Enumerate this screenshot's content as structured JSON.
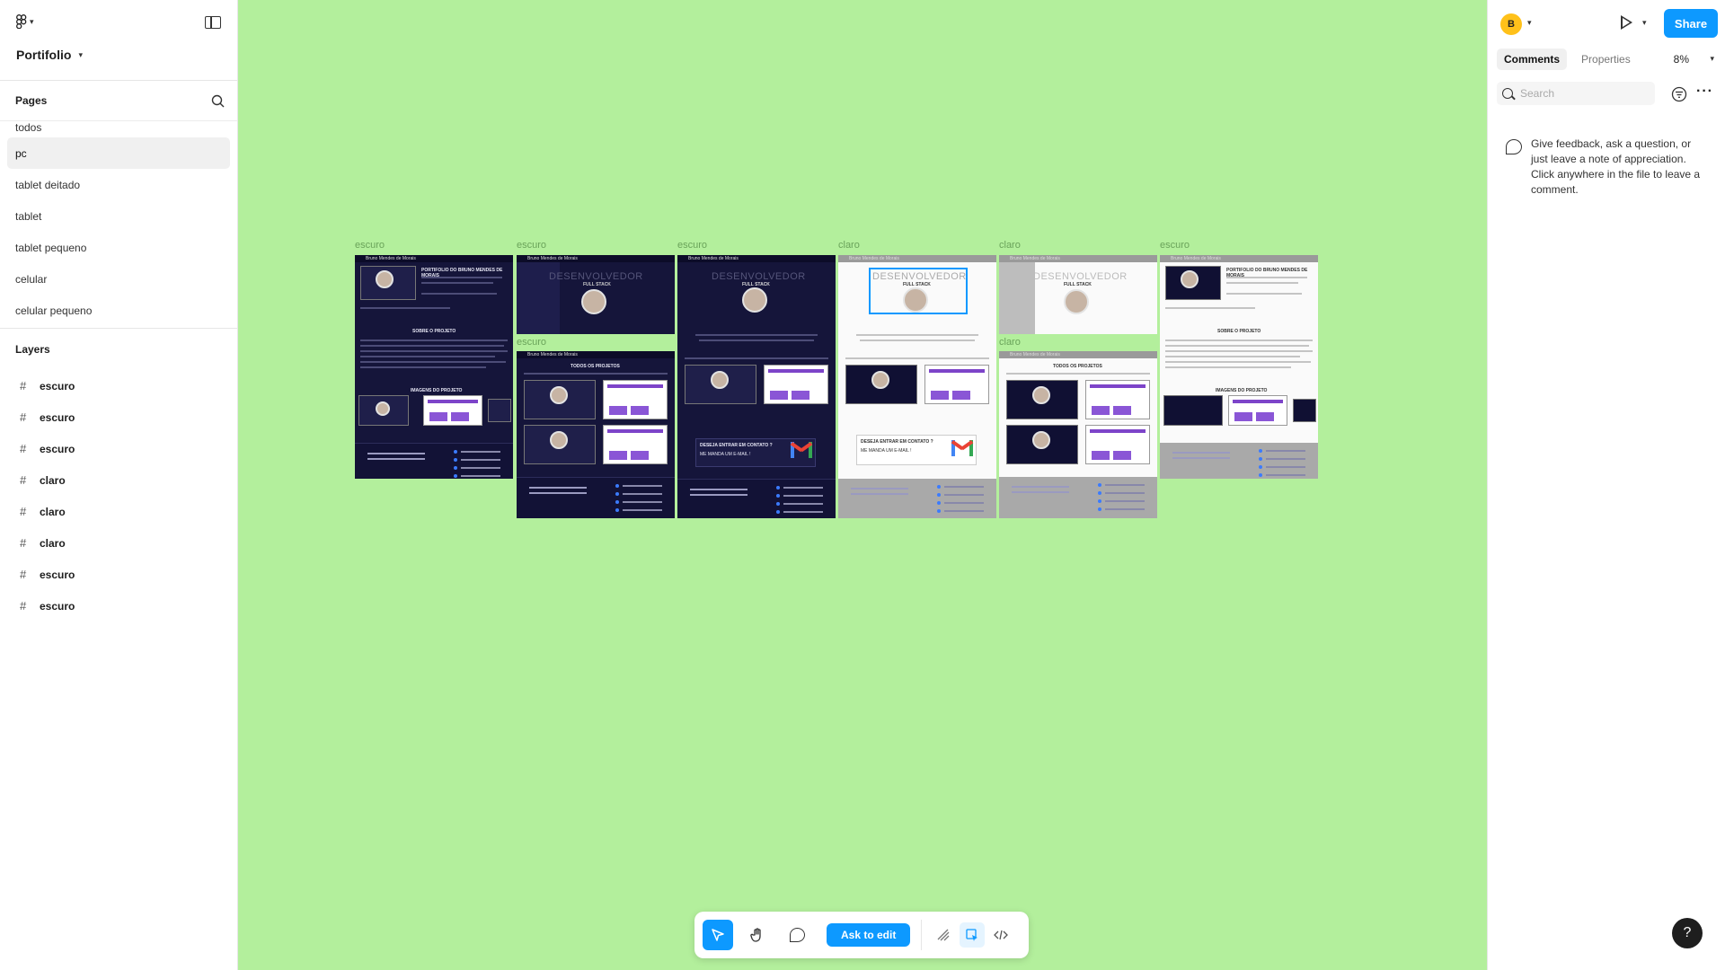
{
  "app": {
    "file_name": "Portifolio"
  },
  "sidebar": {
    "pages_title": "Pages",
    "pages": [
      "todos",
      "pc",
      "tablet deitado",
      "tablet",
      "tablet pequeno",
      "celular",
      "celular pequeno"
    ],
    "selected_page": "pc",
    "layers_title": "Layers",
    "layers": [
      "escuro",
      "escuro",
      "escuro",
      "claro",
      "claro",
      "claro",
      "escuro",
      "escuro"
    ]
  },
  "right_panel": {
    "avatar_letter": "B",
    "share_label": "Share",
    "tabs": [
      "Comments",
      "Properties"
    ],
    "active_tab": "Comments",
    "zoom": "8%",
    "search_placeholder": "Search",
    "empty_message": "Give feedback, ask a question, or just leave a note of appreciation. Click anywhere in the file to leave a comment.",
    "help_label": "?"
  },
  "canvas": {
    "frame_labels": [
      "escuro",
      "escuro",
      "escuro",
      "claro",
      "claro",
      "escuro",
      "escuro",
      "claro"
    ],
    "site_name": "Bruno Mendes de Morais",
    "headline": "PORTIFOLIO DO BRUNO MENDES DE MORAIS",
    "hero_title": "DESENVOLVEDOR",
    "hero_sub": "FULL STACK",
    "about_title": "SOBRE O PROJETO",
    "image_title": "IMAGENS DO PROJETO",
    "projects_title": "TODOS OS PROJETOS",
    "contact_title": "DESEJA ENTRAR EM CONTATO ?",
    "contact_sub": "ME MANDA UM E-MAIL !"
  },
  "toolbar": {
    "ask_label": "Ask to edit"
  },
  "colors": {
    "canvas_bg": "#b3ef9c",
    "accent": "#0d99ff",
    "dark_frame": "#15153a",
    "light_frame": "#fafafa"
  }
}
